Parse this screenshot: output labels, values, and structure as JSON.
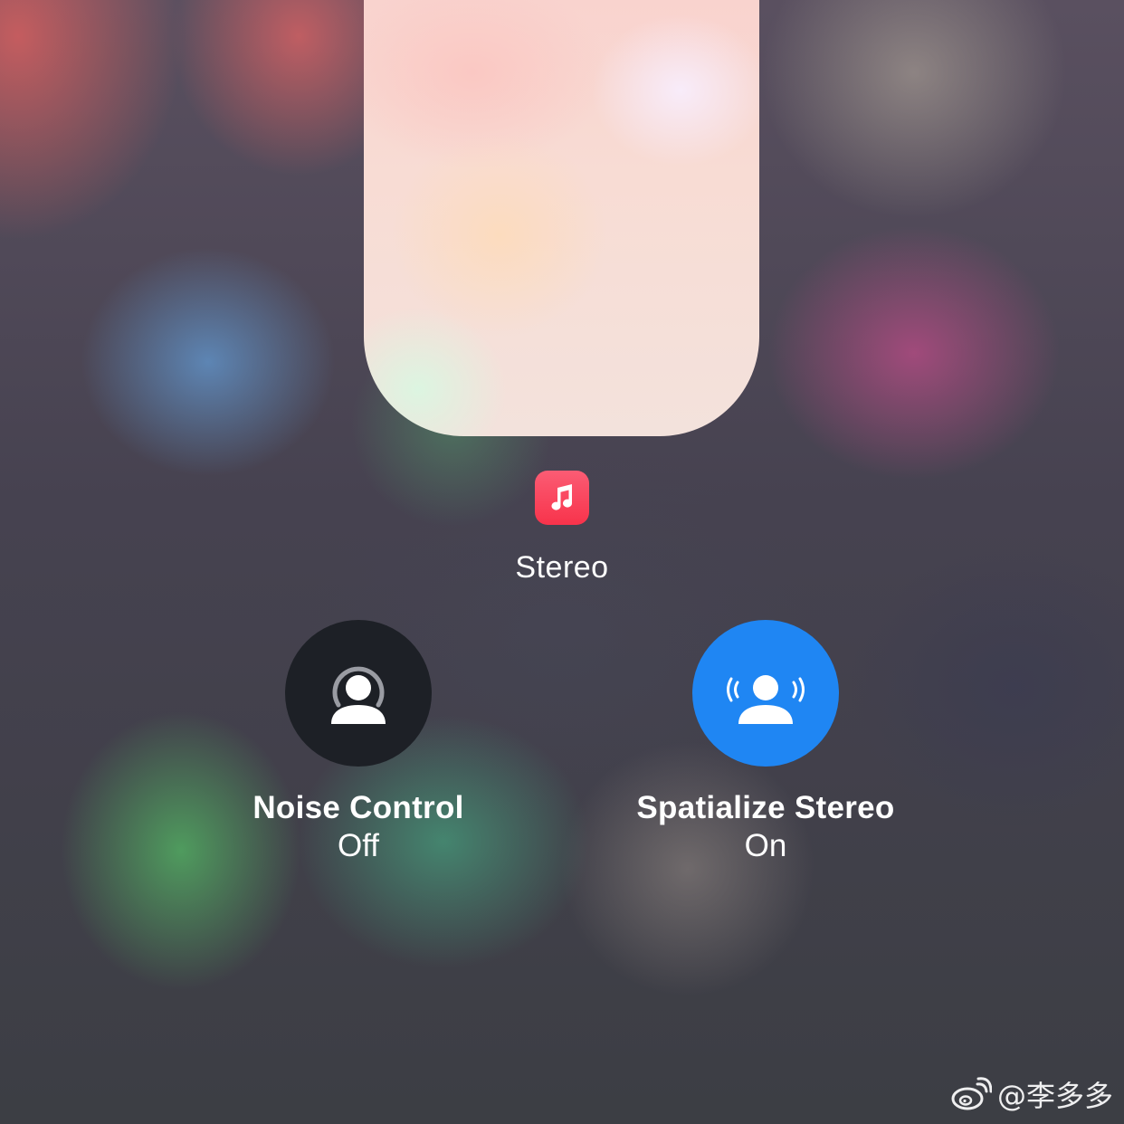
{
  "audio_source": {
    "app_icon": "music-note-icon",
    "app_icon_color": "#f8334b",
    "label": "Stereo"
  },
  "volume": {
    "level": 0.92
  },
  "noise_control": {
    "icon": "person-with-headphones-icon",
    "title": "Noise Control",
    "state": "Off",
    "color": "#1d2026"
  },
  "spatialize_stereo": {
    "icon": "person-with-sound-waves-icon",
    "title": "Spatialize Stereo",
    "state": "On",
    "color": "#1f86f3"
  },
  "watermark": {
    "logo": "weibo-logo",
    "text": "@李多多"
  }
}
